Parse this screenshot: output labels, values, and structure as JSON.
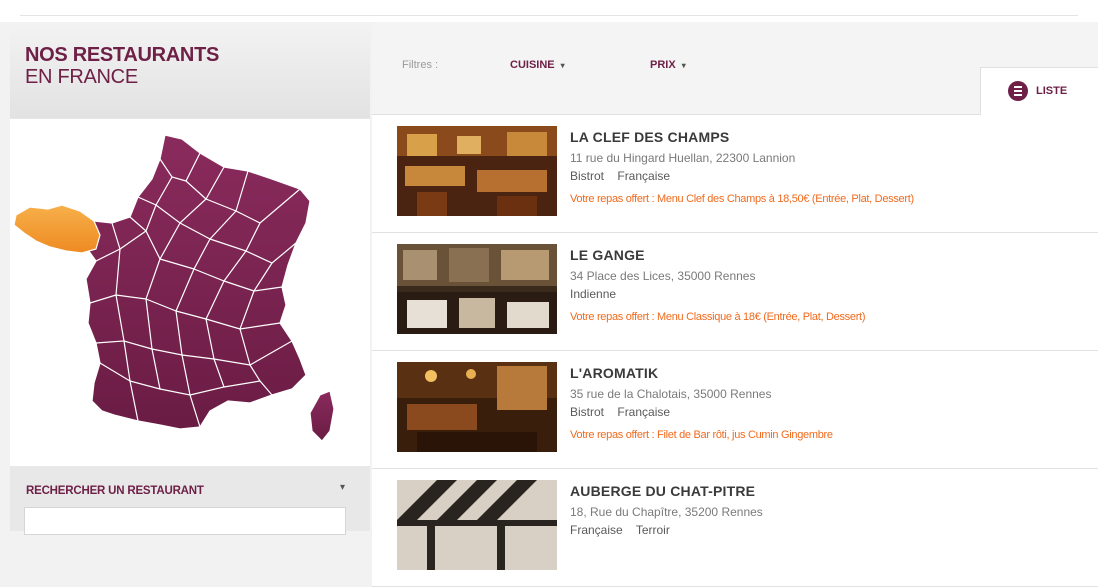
{
  "sidebar": {
    "title_line1": "NOS RESTAURANTS",
    "title_line2": "EN FRANCE",
    "search_title": "RECHERCHER UN RESTAURANT",
    "search_caret": "▾",
    "map": {
      "base_color": "#7a2350",
      "highlight_color": "#f39a32",
      "highlighted_region": "Bretagne"
    }
  },
  "filters": {
    "label": "Filtres :",
    "cuisine": "CUISINE",
    "prix": "PRIX",
    "caret": "▾"
  },
  "view_tab": {
    "label": "LISTE",
    "icon": "list-icon"
  },
  "restaurants": [
    {
      "name": "LA CLEF DES CHAMPS",
      "address": "11 rue du Hingard Huellan, 22300 Lannion",
      "tags": [
        "Bistrot",
        "Française"
      ],
      "offer": "Votre repas offert : Menu Clef des Champs à 18,50€ (Entrée, Plat, Dessert)"
    },
    {
      "name": "LE GANGE",
      "address": "34 Place des Lices, 35000 Rennes",
      "tags": [
        "Indienne"
      ],
      "offer": "Votre repas offert : Menu Classique à 18€ (Entrée, Plat, Dessert)"
    },
    {
      "name": "L'AROMATIK",
      "address": "35 rue de la Chalotais, 35000 Rennes",
      "tags": [
        "Bistrot",
        "Française"
      ],
      "offer": "Votre repas offert : Filet de Bar rôti, jus Cumin Gingembre"
    },
    {
      "name": "AUBERGE DU CHAT-PITRE",
      "address": "18, Rue du Chapître, 35200 Rennes",
      "tags": [
        "Française",
        "Terroir"
      ],
      "offer": ""
    }
  ],
  "colors": {
    "brand": "#6e2047",
    "offer": "#f06a1d"
  }
}
